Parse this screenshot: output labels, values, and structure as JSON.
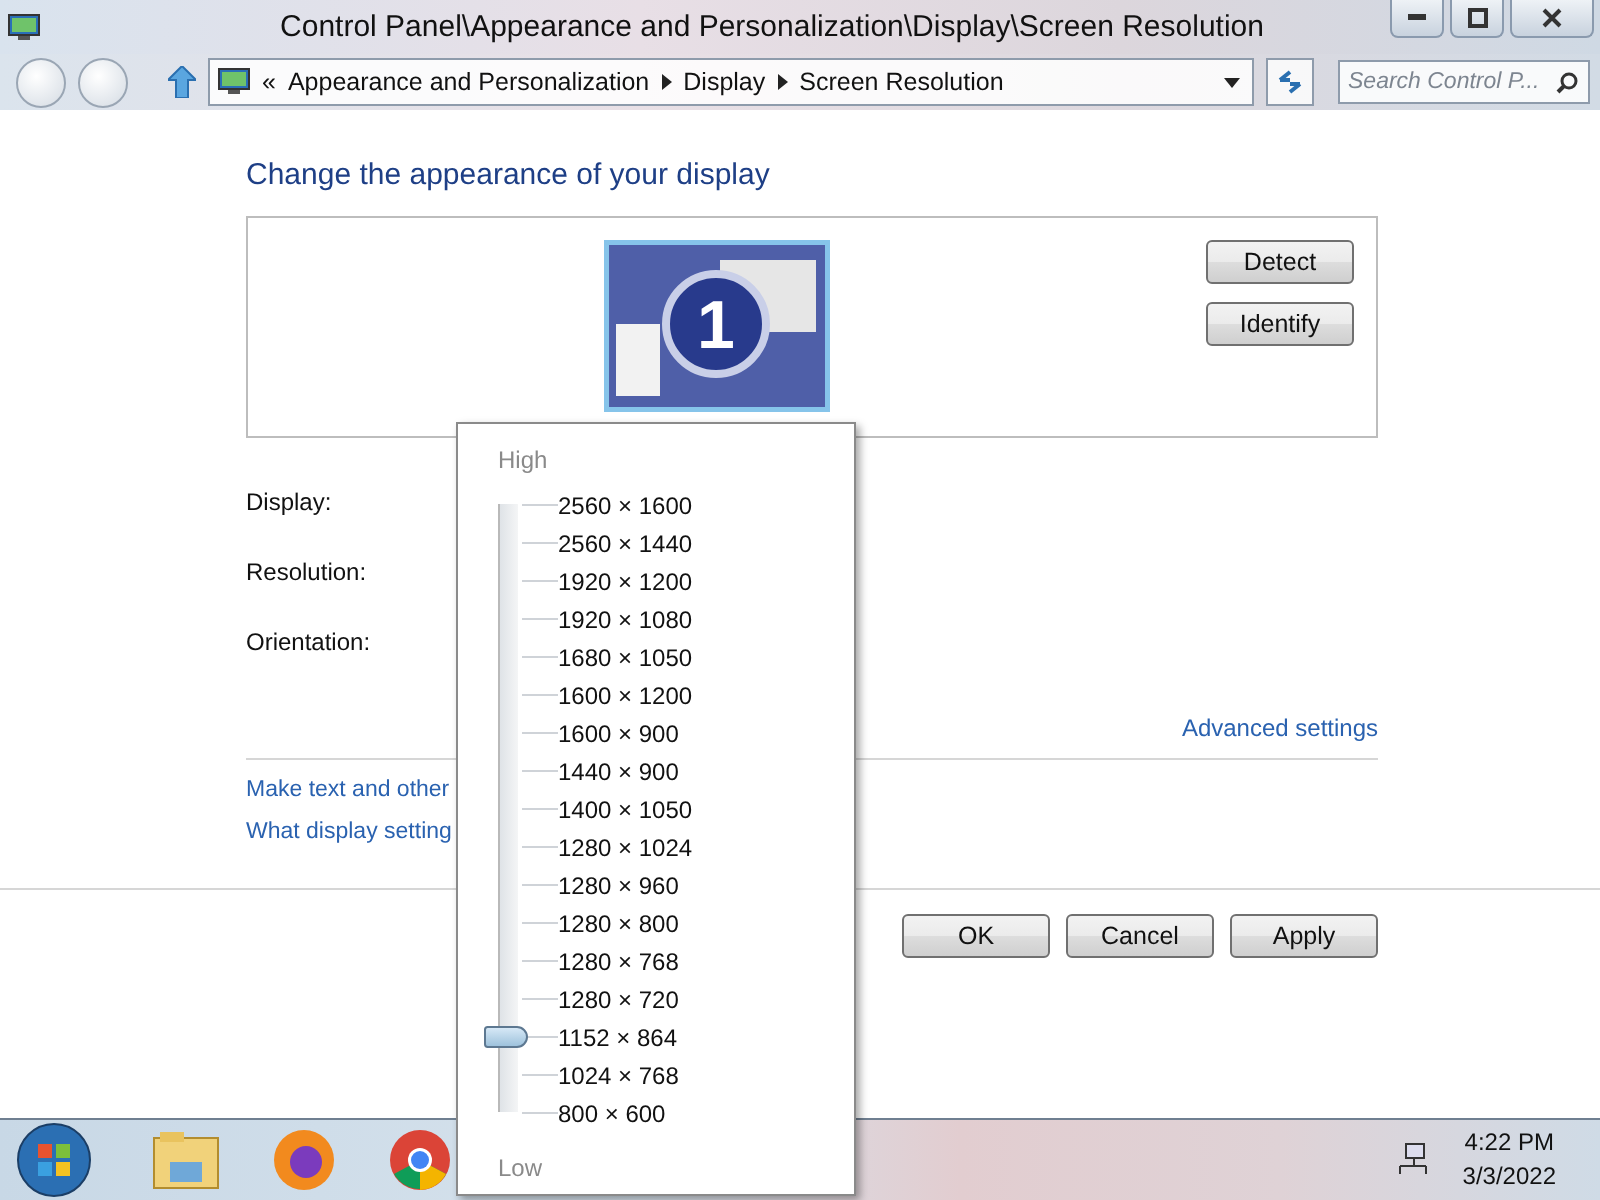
{
  "window": {
    "title": "Control Panel\\Appearance and Personalization\\Display\\Screen Resolution"
  },
  "address_bar": {
    "prefix": "«",
    "crumbs": [
      "Appearance and Personalization",
      "Display",
      "Screen Resolution"
    ]
  },
  "search": {
    "placeholder": "Search Control P..."
  },
  "heading": "Change the appearance of your display",
  "display_preview": {
    "monitor_number": "1",
    "buttons": [
      "Detect",
      "Identify"
    ]
  },
  "settings": [
    "Display:",
    "Resolution:",
    "Orientation:"
  ],
  "advanced_link": "Advanced settings",
  "links": [
    "Make text and other",
    "What display setting"
  ],
  "buttons": [
    "OK",
    "Cancel",
    "Apply"
  ],
  "resolution_popup": {
    "high_label": "High",
    "low_label": "Low",
    "level": 0.125,
    "options": [
      "2560 × 1600",
      "2560 × 1440",
      "1920 × 1200",
      "1920 × 1080",
      "1680 × 1050",
      "1600 × 1200",
      "1600 × 900",
      "1440 × 900",
      "1400 × 1050",
      "1280 × 1024",
      "1280 × 960",
      "1280 × 800",
      "1280 × 768",
      "1280 × 720",
      "1152 × 864",
      "1024 × 768",
      "800 × 600"
    ]
  },
  "taskbar": {
    "time": "4:22 PM",
    "date": "3/3/2022"
  }
}
